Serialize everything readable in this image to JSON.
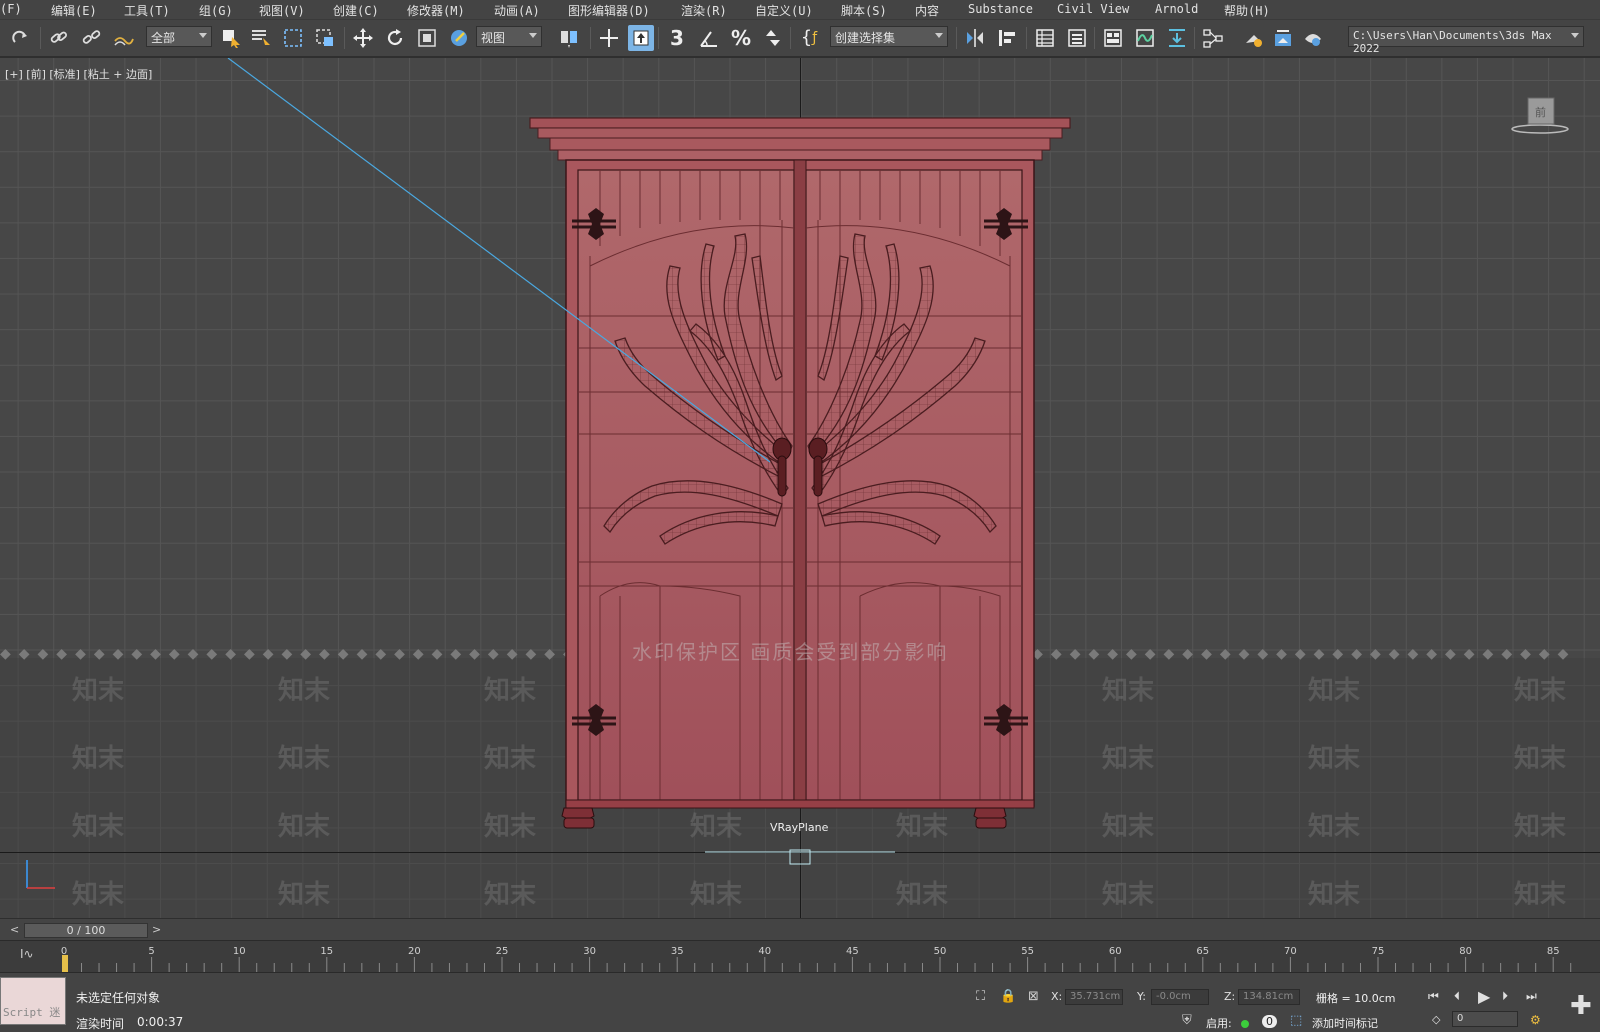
{
  "menu": [
    "(F)",
    "编辑(E)",
    "工具(T)",
    "组(G)",
    "视图(V)",
    "创建(C)",
    "修改器(M)",
    "动画(A)",
    "图形编辑器(D)",
    "渲染(R)",
    "自定义(U)",
    "脚本(S)",
    "内容",
    "Substance",
    "Civil View",
    "Arnold",
    "帮助(H)"
  ],
  "toolbar": {
    "selection_filter": "全部",
    "ref_coord": "视图",
    "named_selection": "创建选择集",
    "path": "C:\\Users\\Han\\Documents\\3ds Max 2022",
    "snap_number": "3"
  },
  "viewport": {
    "label": "[+] [前] [标准] [粘土 + 边面]",
    "object_label": "VRayPlane",
    "watermark_center": "水印保护区   画质会受到部分影响",
    "watermark_text": "知末",
    "navcube_label": "前"
  },
  "timeline": {
    "slider": "0 / 100",
    "left_arrow": "<",
    "right_arrow": ">",
    "ticks": [
      "0",
      "5",
      "10",
      "15",
      "20",
      "25",
      "30",
      "35",
      "40",
      "45",
      "50",
      "55",
      "60",
      "65",
      "70",
      "75",
      "80",
      "85"
    ]
  },
  "status": {
    "script_label": "Script 迷",
    "selection": "未选定任何对象",
    "render_time_label": "渲染时间",
    "render_time": "0:00:37",
    "x_label": "X:",
    "x_value": "35.731cm",
    "y_label": "Y:",
    "y_value": "-0.0cm",
    "z_label": "Z:",
    "z_value": "134.81cm",
    "grid": "栅格 = 10.0cm",
    "enable": "启用:",
    "enable_count": "0",
    "add_time_tag": "添加时间标记",
    "frame_field": "0"
  },
  "colors": {
    "model": "#a5555a",
    "highlight": "#7db5e6",
    "time_marker": "#e6c04a"
  }
}
